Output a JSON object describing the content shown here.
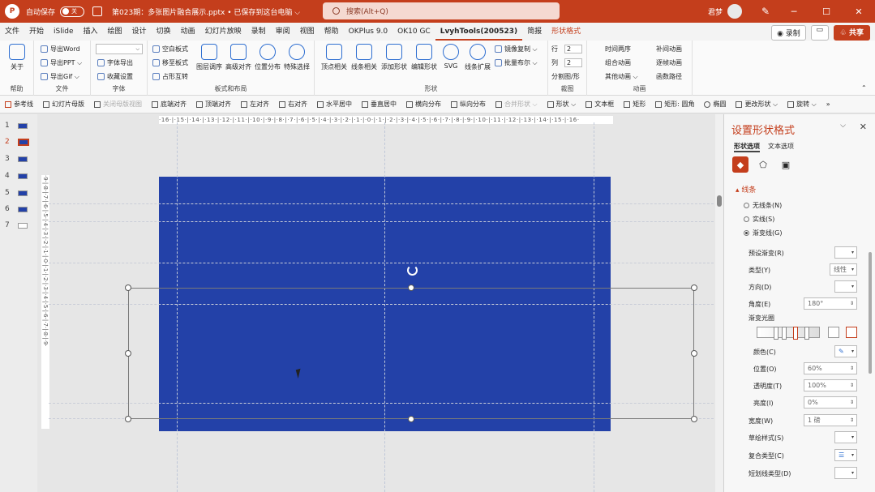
{
  "titlebar": {
    "autosave_label": "自动保存",
    "autosave_state": "关",
    "doc_title": "第023期：多张图片融合展示.pptx • 已保存到这台电脑 ⌵",
    "search_placeholder": "搜索(Alt+Q)",
    "user_name": "君梦",
    "minimize": "─",
    "maximize": "☐",
    "close": "✕"
  },
  "menubar": {
    "tabs": [
      "文件",
      "开始",
      "iSlide",
      "插入",
      "绘图",
      "设计",
      "切换",
      "动画",
      "幻灯片放映",
      "录制",
      "审阅",
      "视图",
      "帮助",
      "OKPlus 9.0",
      "OK10 GC",
      "LvyhTools(200523)",
      "简报",
      "形状格式"
    ],
    "record_label": "◉ 录制",
    "share_label": "♧ 共享"
  },
  "ribbon": {
    "help": {
      "btn": "关于",
      "group": "帮助"
    },
    "file": {
      "items": [
        "导出Word",
        "导出PPT ⌵",
        "导出Gif ⌵"
      ],
      "group": "文件"
    },
    "font": {
      "items": [
        "字体导出",
        "收藏设置"
      ],
      "group": "字体"
    },
    "layout": {
      "items": [
        "空白板式",
        "移至板式",
        "占形互转"
      ],
      "big": [
        "图层调序",
        "高级对齐",
        "位置分布",
        "特殊选择"
      ],
      "group": "板式和布局"
    },
    "shape": {
      "big": [
        "顶点相关",
        "线条相关",
        "添加形状",
        "编辑形状",
        "SVG",
        "线条扩展"
      ],
      "items": [
        "镜像复制 ⌵",
        "批量布尔 ⌵"
      ],
      "group": "形状"
    },
    "crop": {
      "row_label": "行",
      "row_value": "2",
      "col_label": "列",
      "col_value": "2",
      "split": "分割图/形",
      "group": "裁图"
    },
    "anim": {
      "items": [
        "时间两序",
        "组合动画",
        "其他动画 ⌵",
        "补间动画",
        "逐帧动画",
        "函数路径"
      ],
      "group": "动画"
    }
  },
  "toolbar2": {
    "items": [
      "参考线",
      "幻灯片母版",
      "关闭母版视图",
      "底端对齐",
      "顶端对齐",
      "左对齐",
      "右对齐",
      "水平居中",
      "垂直居中",
      "横向分布",
      "纵向分布",
      "合并形状 ⌵",
      "形状 ⌵",
      "文本框",
      "矩形",
      "矩形: 圆角",
      "椭圆",
      "更改形状 ⌵",
      "旋转 ⌵",
      "»"
    ]
  },
  "thumbnails": [
    "1",
    "2",
    "3",
    "4",
    "5",
    "6",
    "7"
  ],
  "ruler": {
    "top": "·16·|·15·|·14·|·13·|·12·|·11·|·10·|·9·|·8·|·7·|·6·|·5·|·4·|·3·|·2·|·1·|·0·|·1·|·2·|·3·|·4·|·5·|·6·|·7·|·8·|·9·|·10·|·11·|·12·|·13·|·14·|·15·|·16·",
    "left": "·9·|·8·|·7·|·6·|·5·|·4·|·3·|·2·|·1·|·0·|·1·|·2·|·3·|·4·|·5·|·6·|·7·|·8·|·9·"
  },
  "panel": {
    "title": "设置形状格式",
    "tab_shape": "形状选项",
    "tab_text": "文本选项",
    "section": "线条",
    "radio": [
      "无线条(N)",
      "实线(S)",
      "渐变线(G)"
    ],
    "labels": {
      "preset": "预设渐变(R)",
      "type": "类型(Y)",
      "direction": "方向(D)",
      "angle": "角度(E)",
      "stops": "渐变光圈",
      "color": "颜色(C)",
      "position": "位置(O)",
      "transparency": "透明度(T)",
      "brightness": "亮度(I)",
      "width": "宽度(W)",
      "compound": "草绘样式(S)",
      "compound_type": "复合类型(C)",
      "dash": "短划线类型(D)"
    },
    "values": {
      "type": "线性",
      "angle": "180°",
      "position": "60%",
      "transparency": "100%",
      "brightness": "0%",
      "width": "1 磅"
    }
  },
  "colors": {
    "accent": "#c43e1c",
    "slide_fill": "#2341a8"
  }
}
